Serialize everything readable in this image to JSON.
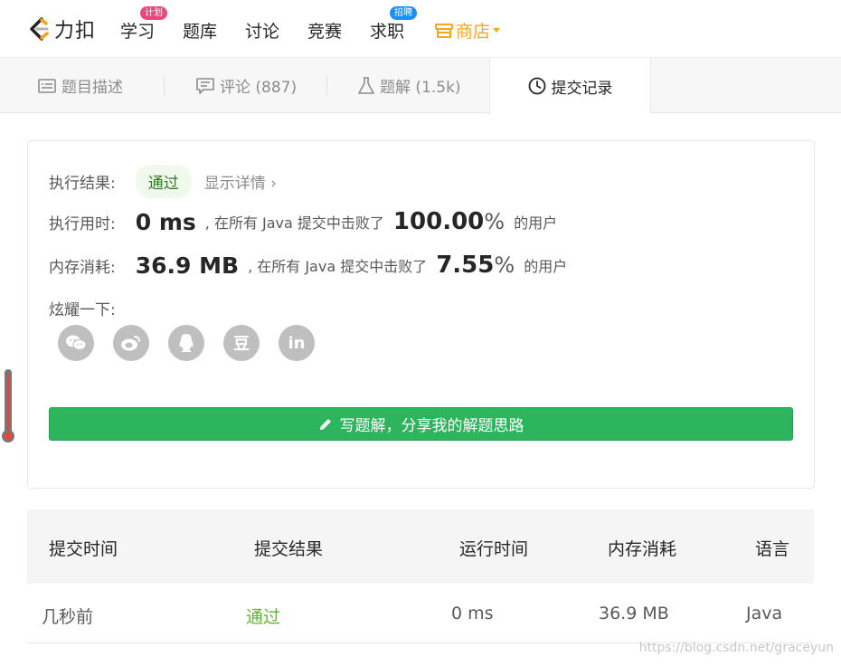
{
  "nav": {
    "logo_text": "力扣",
    "items": [
      {
        "label": "学习",
        "badge": "计划"
      },
      {
        "label": "题库"
      },
      {
        "label": "讨论"
      },
      {
        "label": "竞赛"
      },
      {
        "label": "求职",
        "badge": "招聘"
      },
      {
        "label": "商店"
      }
    ]
  },
  "tabs": [
    {
      "label": "题目描述"
    },
    {
      "label": "评论 (887)"
    },
    {
      "label": "题解 (1.5k)"
    },
    {
      "label": "提交记录"
    }
  ],
  "result": {
    "exec_label": "执行结果:",
    "status": "通过",
    "detail_link": "显示详情",
    "time_label": "执行用时:",
    "time_value": "0 ms",
    "time_text": ", 在所有 Java 提交中击败了",
    "time_pct": "100.00",
    "pct_unit": "%",
    "users_text": "的用户",
    "mem_label": "内存消耗:",
    "mem_value": "36.9 MB",
    "mem_text": ", 在所有 Java 提交中击败了",
    "mem_pct": "7.55",
    "share_label": "炫耀一下:",
    "share_icons": [
      "wechat-icon",
      "weibo-icon",
      "qq-icon",
      "douban-icon",
      "linkedin-icon"
    ],
    "douban_glyph": "豆",
    "linkedin_glyph": "in",
    "write_button": "写题解，分享我的解题思路"
  },
  "table": {
    "headers": [
      "提交时间",
      "提交结果",
      "运行时间",
      "内存消耗",
      "语言"
    ],
    "rows": [
      {
        "time": "几秒前",
        "result": "通过",
        "runtime": "0 ms",
        "memory": "36.9 MB",
        "lang": "Java"
      }
    ]
  },
  "watermark": "https://blog.csdn.net/graceyun",
  "colors": {
    "accent_green": "#2db55d",
    "pass_green": "#5cb82a",
    "store_orange": "#f5a623"
  }
}
